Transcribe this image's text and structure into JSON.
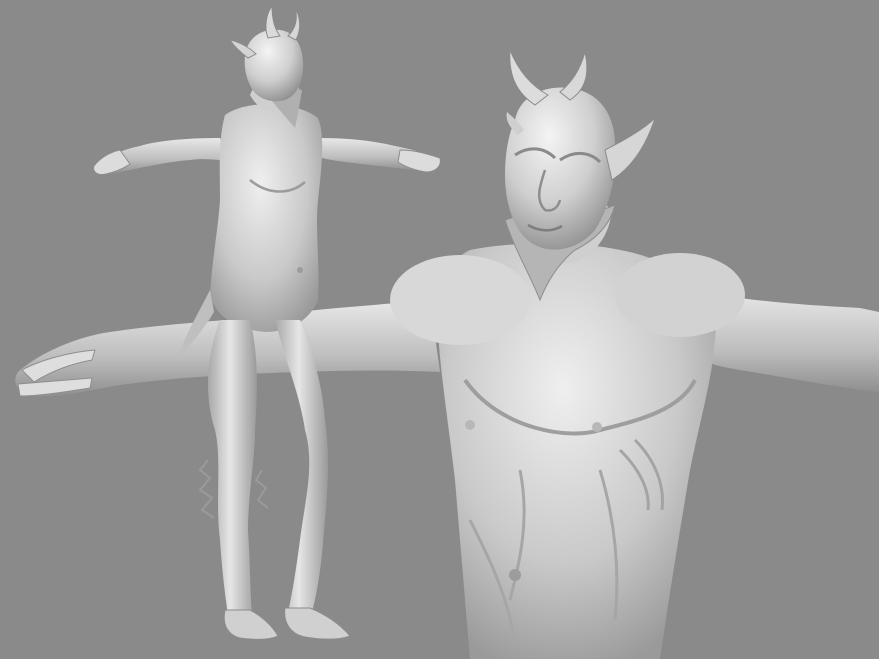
{
  "viewport": {
    "background_color": "#8a8a8a",
    "model_color": "#d4d4d4",
    "shadow_color": "#6e6e6e",
    "highlight_color": "#f2f2f2"
  },
  "subjects": [
    {
      "name": "full-body-sculpt",
      "pose": "T-pose",
      "description_icon": "horned-satyr-figure-icon"
    },
    {
      "name": "bust-closeup-sculpt",
      "pose": "T-pose",
      "description_icon": "horned-satyr-bust-icon"
    }
  ]
}
